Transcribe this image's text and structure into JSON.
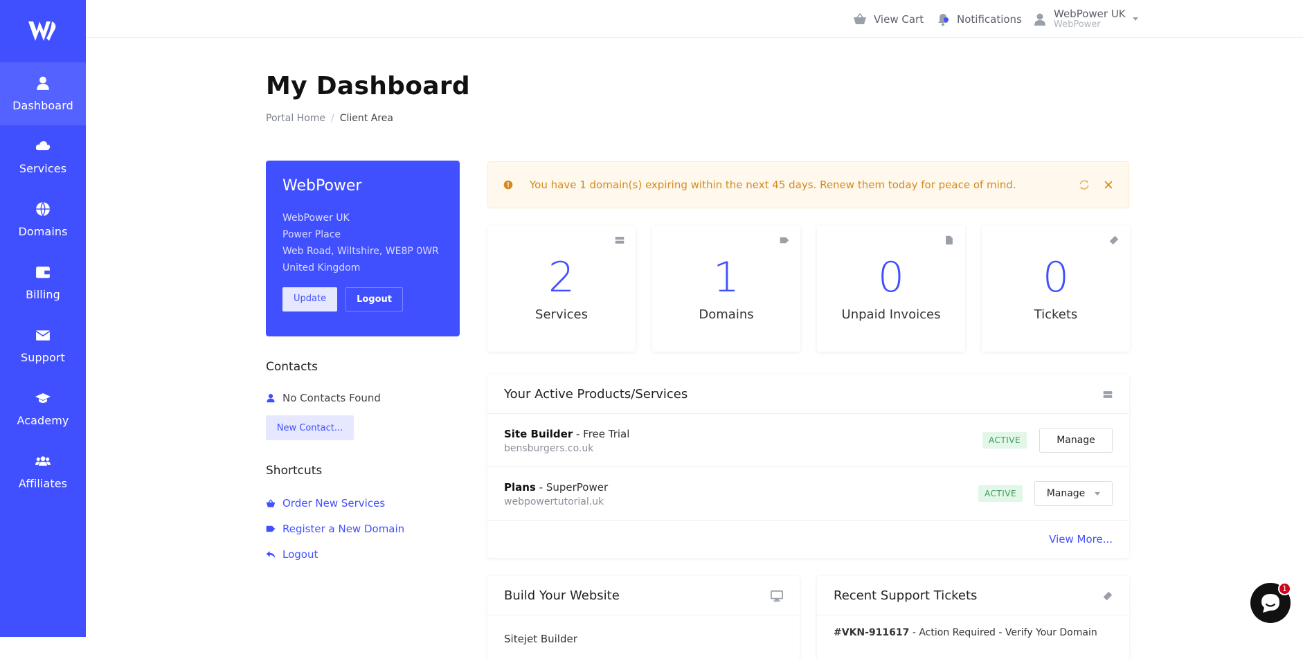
{
  "sidebar": {
    "items": [
      {
        "label": "Dashboard",
        "icon": "user-icon"
      },
      {
        "label": "Services",
        "icon": "cloud-icon"
      },
      {
        "label": "Domains",
        "icon": "globe-icon"
      },
      {
        "label": "Billing",
        "icon": "wallet-icon"
      },
      {
        "label": "Support",
        "icon": "envelope-icon"
      },
      {
        "label": "Academy",
        "icon": "graduation-cap-icon"
      },
      {
        "label": "Affiliates",
        "icon": "users-icon"
      }
    ]
  },
  "topbar": {
    "cart": "View Cart",
    "notifications": "Notifications",
    "user_name": "WebPower UK",
    "user_company": "WebPower"
  },
  "page": {
    "title": "My Dashboard",
    "breadcrumb": [
      "Portal Home",
      "Client Area"
    ]
  },
  "client": {
    "name": "WebPower",
    "address": [
      "WebPower UK",
      "Power Place",
      "Web Road, Wiltshire, WE8P 0WR",
      "United Kingdom"
    ],
    "update_label": "Update",
    "logout_label": "Logout"
  },
  "contacts": {
    "heading": "Contacts",
    "empty": "No Contacts Found",
    "new_label": "New Contact..."
  },
  "shortcuts": {
    "heading": "Shortcuts",
    "items": [
      "Order New Services",
      "Register a New Domain",
      "Logout"
    ]
  },
  "alert": {
    "text": "You have 1 domain(s) expiring within the next 45 days. Renew them today for peace of mind."
  },
  "stats": [
    {
      "value": "2",
      "label": "Services"
    },
    {
      "value": "1",
      "label": "Domains"
    },
    {
      "value": "0",
      "label": "Unpaid Invoices"
    },
    {
      "value": "0",
      "label": "Tickets"
    }
  ],
  "products": {
    "heading": "Your Active Products/Services",
    "rows": [
      {
        "name": "Site Builder",
        "plan": " - Free Trial",
        "domain": "bensburgers.co.uk",
        "status": "ACTIVE",
        "action": "Manage"
      },
      {
        "name": "Plans",
        "plan": " - SuperPower",
        "domain": "webpowertutorial.uk",
        "status": "ACTIVE",
        "action": "Manage"
      }
    ],
    "view_more": "View More..."
  },
  "build": {
    "heading": "Build Your Website",
    "first_item": "Sitejet Builder"
  },
  "tickets": {
    "heading": "Recent Support Tickets",
    "first_id": "#VKN-911617",
    "first_subject": " - Action Required - Verify Your Domain"
  },
  "chat": {
    "badge": "1"
  },
  "colors": {
    "brand": "#4150ff",
    "alert_text": "#d48a1d",
    "active_badge": "#3c9a5a"
  }
}
